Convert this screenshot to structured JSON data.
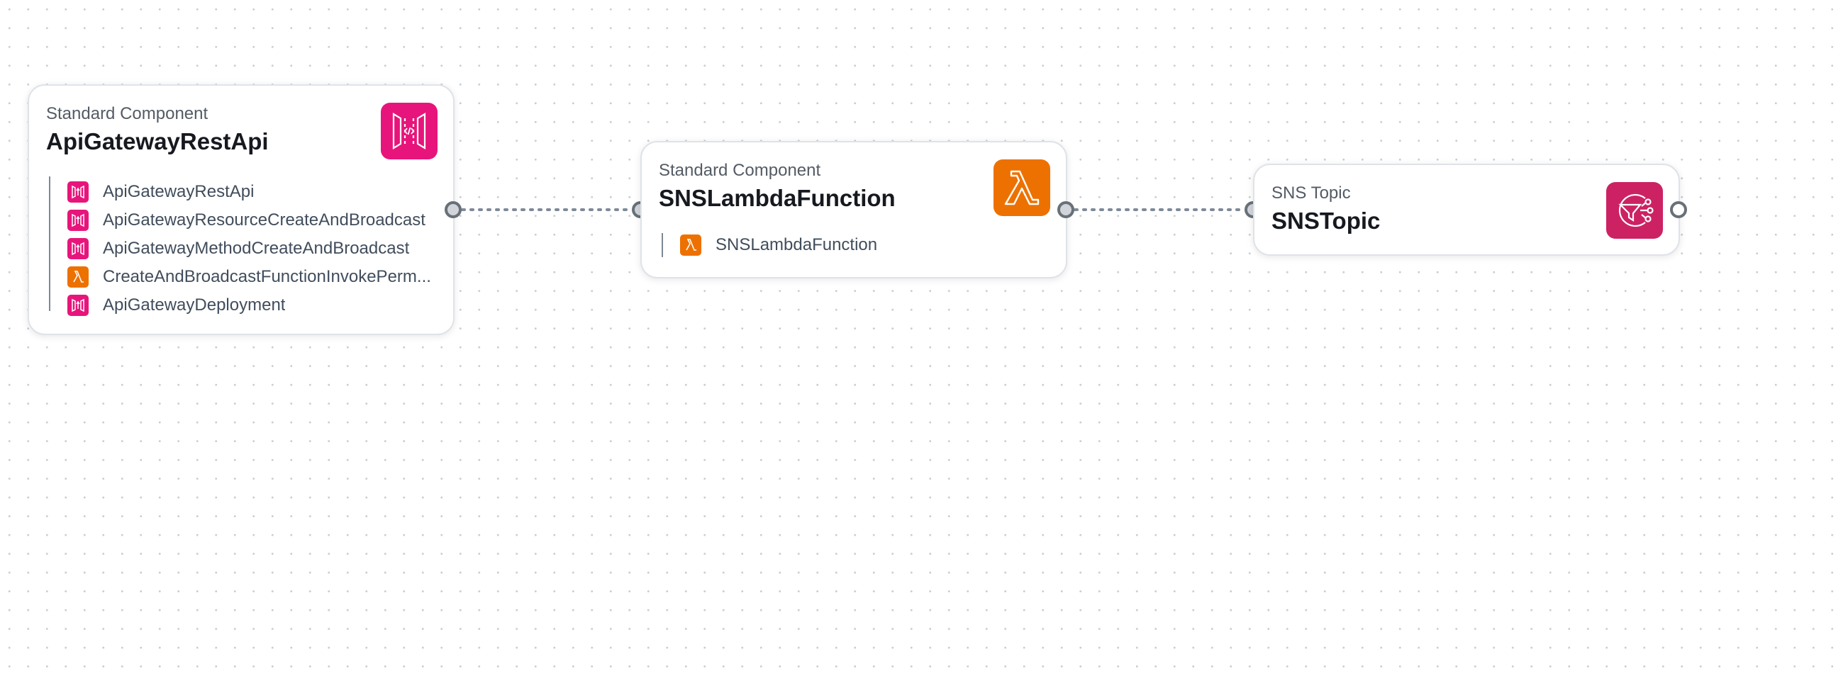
{
  "nodes": {
    "api": {
      "type_label": "Standard Component",
      "title": "ApiGatewayRestApi",
      "icon": "api-gateway-icon",
      "color": "#e7157b",
      "resources": [
        {
          "label": "ApiGatewayRestApi",
          "icon": "api-gateway-icon",
          "color": "#e7157b"
        },
        {
          "label": "ApiGatewayResourceCreateAndBroadcast",
          "icon": "api-gateway-icon",
          "color": "#e7157b"
        },
        {
          "label": "ApiGatewayMethodCreateAndBroadcast",
          "icon": "api-gateway-icon",
          "color": "#e7157b"
        },
        {
          "label": "CreateAndBroadcastFunctionInvokePerm...",
          "icon": "lambda-icon",
          "color": "#ed7100"
        },
        {
          "label": "ApiGatewayDeployment",
          "icon": "api-gateway-icon",
          "color": "#e7157b"
        }
      ]
    },
    "lambda": {
      "type_label": "Standard Component",
      "title": "SNSLambdaFunction",
      "icon": "lambda-icon",
      "color": "#ed7100",
      "resources": [
        {
          "label": "SNSLambdaFunction",
          "icon": "lambda-icon",
          "color": "#ed7100"
        }
      ]
    },
    "sns": {
      "type_label": "SNS Topic",
      "title": "SNSTopic",
      "icon": "sns-icon",
      "color": "#cc2264"
    }
  },
  "edges": [
    {
      "from": "ApiGatewayRestApi",
      "to": "SNSLambdaFunction",
      "style": "dotted"
    },
    {
      "from": "SNSLambdaFunction",
      "to": "SNSTopic",
      "style": "dotted"
    }
  ]
}
